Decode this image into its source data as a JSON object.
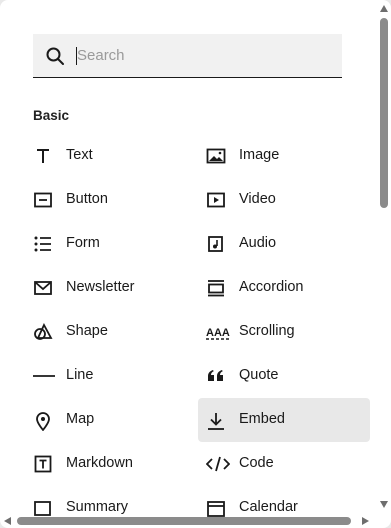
{
  "search": {
    "placeholder": "Search",
    "value": ""
  },
  "section_title": "Basic",
  "items": [
    {
      "label": "Text",
      "icon": "text-icon"
    },
    {
      "label": "Image",
      "icon": "image-icon"
    },
    {
      "label": "Button",
      "icon": "button-icon"
    },
    {
      "label": "Video",
      "icon": "video-icon"
    },
    {
      "label": "Form",
      "icon": "form-icon"
    },
    {
      "label": "Audio",
      "icon": "audio-icon"
    },
    {
      "label": "Newsletter",
      "icon": "envelope-icon"
    },
    {
      "label": "Accordion",
      "icon": "accordion-icon"
    },
    {
      "label": "Shape",
      "icon": "shape-icon"
    },
    {
      "label": "Scrolling",
      "icon": "scrolling-icon"
    },
    {
      "label": "Line",
      "icon": "line-icon"
    },
    {
      "label": "Quote",
      "icon": "quote-icon"
    },
    {
      "label": "Map",
      "icon": "map-pin-icon"
    },
    {
      "label": "Embed",
      "icon": "embed-icon",
      "active": true
    },
    {
      "label": "Markdown",
      "icon": "markdown-icon"
    },
    {
      "label": "Code",
      "icon": "code-icon"
    },
    {
      "label": "Summary",
      "icon": "summary-icon"
    },
    {
      "label": "Calendar",
      "icon": "calendar-icon"
    }
  ]
}
